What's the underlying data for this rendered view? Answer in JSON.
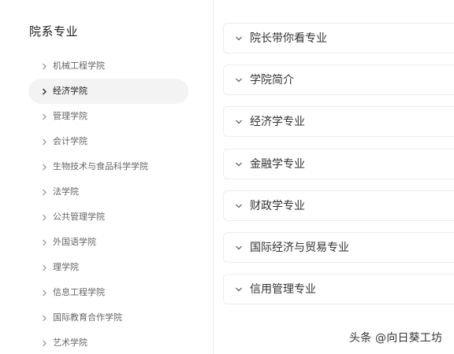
{
  "sidebar": {
    "title": "院系专业",
    "items": [
      {
        "label": "机械工程学院"
      },
      {
        "label": "经济学院"
      },
      {
        "label": "管理学院"
      },
      {
        "label": "会计学院"
      },
      {
        "label": "生物技术与食品科学学院"
      },
      {
        "label": "法学院"
      },
      {
        "label": "公共管理学院"
      },
      {
        "label": "外国语学院"
      },
      {
        "label": "理学院"
      },
      {
        "label": "信息工程学院"
      },
      {
        "label": "国际教育合作学院"
      },
      {
        "label": "艺术学院"
      }
    ],
    "active_index": 1
  },
  "sections": [
    {
      "label": "院长带你看专业"
    },
    {
      "label": "学院简介"
    },
    {
      "label": "经济学专业"
    },
    {
      "label": "金融学专业"
    },
    {
      "label": "财政学专业"
    },
    {
      "label": "国际经济与贸易专业"
    },
    {
      "label": "信用管理专业"
    }
  ],
  "watermark": "头条 @向日葵工坊"
}
